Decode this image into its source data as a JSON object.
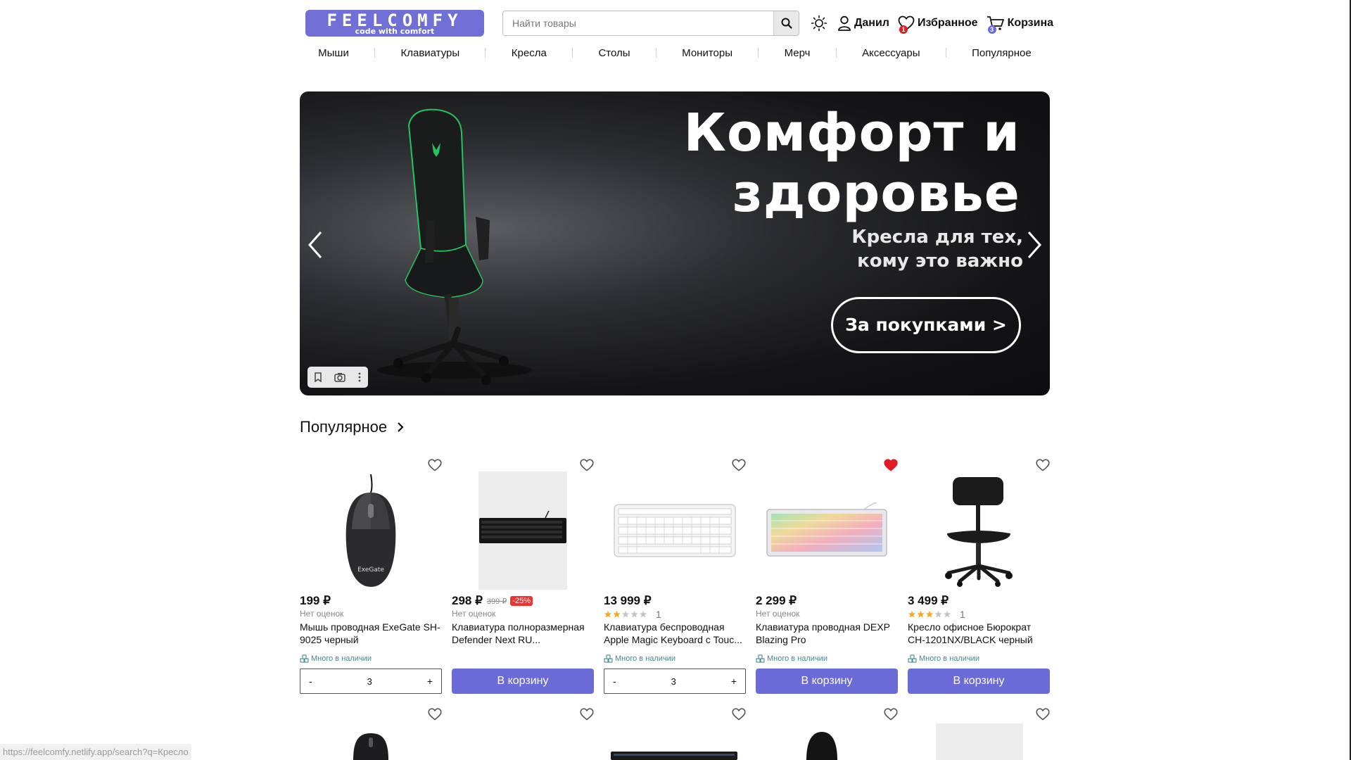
{
  "header": {
    "logo_main": "FEELCOMFY",
    "logo_tagline": "code with comfort",
    "search_placeholder": "Найти товары",
    "user_label": "Данил",
    "favorites_label": "Избранное",
    "favorites_count": "1",
    "cart_label": "Корзина",
    "cart_count": "3"
  },
  "nav": {
    "items": [
      "Мыши",
      "Клавиатуры",
      "Кресла",
      "Столы",
      "Мониторы",
      "Мерч",
      "Аксессуары",
      "Популярное"
    ]
  },
  "banner": {
    "title_line1": "Комфорт и",
    "title_line2": "здоровье",
    "subtitle_line1": "Кресла для тех,",
    "subtitle_line2": "кому это важно",
    "cta": "За покупками >"
  },
  "section": {
    "title": "Популярное"
  },
  "products": [
    {
      "price": "199 ₽",
      "rating_text": "Нет оценок",
      "name": "Мышь проводная ExeGate SH-9025 черный",
      "stock": "Много в наличии",
      "qty": "3",
      "qty_minus": "-",
      "qty_plus": "+",
      "favorited": false
    },
    {
      "price": "298 ₽",
      "old_price": "399 ₽",
      "discount": "-25%",
      "rating_text": "Нет оценок",
      "name": "Клавиатура полноразмерная Defender Next RU...",
      "buy_label": "В корзину",
      "favorited": false
    },
    {
      "price": "13 999 ₽",
      "rating_stars": 2,
      "rating_count": "1",
      "name": "Клавиатура беспроводная Apple Magic Keyboard с Touc...",
      "stock": "Много в наличии",
      "qty": "3",
      "qty_minus": "-",
      "qty_plus": "+",
      "favorited": false
    },
    {
      "price": "2 299 ₽",
      "rating_text": "Нет оценок",
      "name": "Клавиатура проводная DEXP Blazing Pro",
      "stock": "Много в наличии",
      "buy_label": "В корзину",
      "favorited": true
    },
    {
      "price": "3 499 ₽",
      "rating_stars": 3,
      "rating_count": "1",
      "name": "Кресло офисное Бюрократ CH-1201NX/BLACK черный",
      "stock": "Много в наличии",
      "buy_label": "В корзину",
      "favorited": false
    }
  ],
  "status_url": "https://feelcomfy.netlify.app/search?q=Кресло",
  "colors": {
    "accent": "#6b6bd8",
    "favorite_red": "#e01b24",
    "stock_teal": "#4a8a8a",
    "discount_red": "#e33333"
  }
}
